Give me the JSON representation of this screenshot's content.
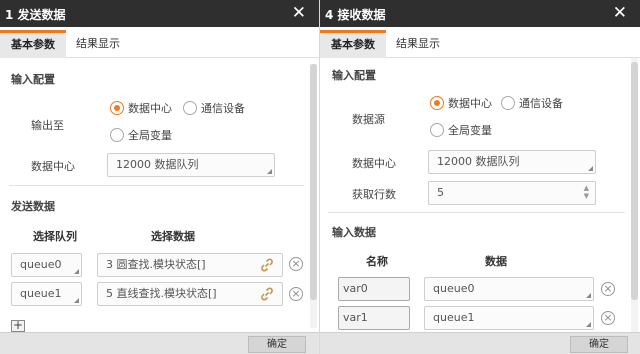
{
  "left": {
    "title": "1 发送数据",
    "close": "✕",
    "tabs": [
      "基本参数",
      "结果显示"
    ],
    "input_config": {
      "heading": "输入配置",
      "output_label": "输出至",
      "options": [
        "数据中心",
        "通信设备",
        "全局变量"
      ],
      "selected": "数据中心",
      "datacenter_label": "数据中心",
      "datacenter_value": "12000 数据队列"
    },
    "send_data": {
      "heading": "发送数据",
      "col_queue": "选择队列",
      "col_data": "选择数据",
      "rows": [
        {
          "queue": "queue0",
          "data": "3 圆查找.模块状态[]"
        },
        {
          "queue": "queue1",
          "data": "5 直线查找.模块状态[]"
        }
      ],
      "add": "+"
    },
    "ok_label": "确定"
  },
  "right": {
    "title": "4 接收数据",
    "close": "✕",
    "tabs": [
      "基本参数",
      "结果显示"
    ],
    "input_config": {
      "heading": "输入配置",
      "source_label": "数据源",
      "options": [
        "数据中心",
        "通信设备",
        "全局变量"
      ],
      "selected": "数据中心",
      "datacenter_label": "数据中心",
      "datacenter_value": "12000 数据队列",
      "rows_label": "获取行数",
      "rows_value": "5"
    },
    "input_data": {
      "heading": "输入数据",
      "col_name": "名称",
      "col_data": "数据",
      "rows": [
        {
          "name": "var0",
          "data": "queue0"
        },
        {
          "name": "var1",
          "data": "queue1"
        }
      ]
    },
    "ok_label": "确定"
  },
  "colors": {
    "accent": "#f07a1e",
    "titlebar": "#2f2f2f",
    "footer": "#e4e4e4"
  }
}
